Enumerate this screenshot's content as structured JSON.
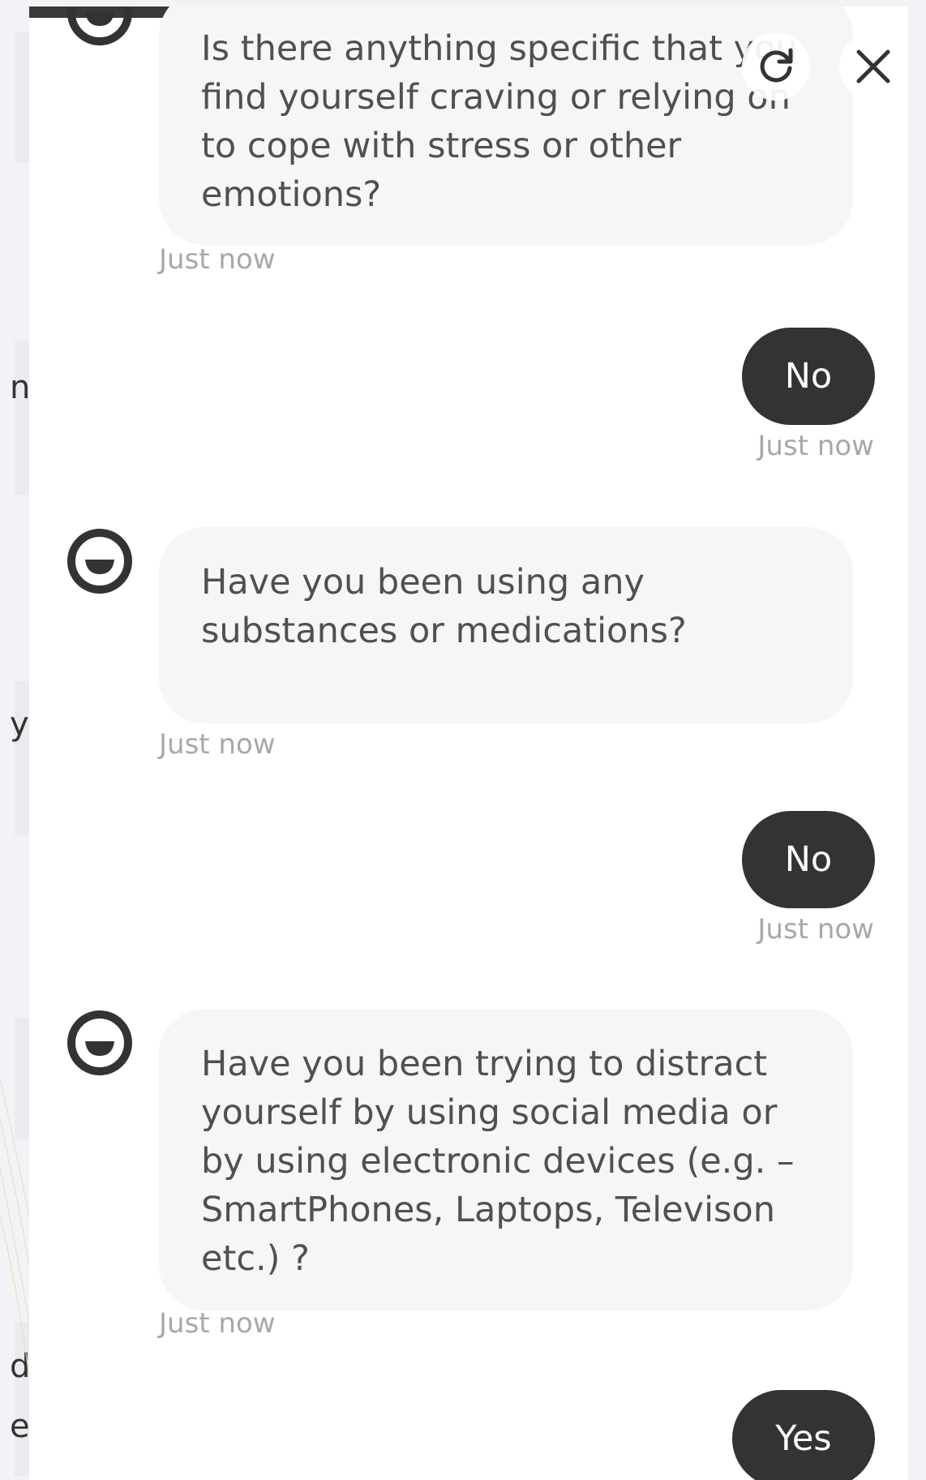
{
  "background": {
    "fragments": [
      "n",
      "y",
      "di",
      "e"
    ]
  },
  "chat": {
    "controls": {
      "refresh_icon": "refresh-icon",
      "close_icon": "close-icon"
    },
    "messages": [
      {
        "sender": "bot",
        "text": "Is there anything specific that you find yourself craving or relying on to cope with stress or other emotions?",
        "time": "Just now"
      },
      {
        "sender": "user",
        "text": "No",
        "time": "Just now"
      },
      {
        "sender": "bot",
        "text": "Have you been using any substances or medications?",
        "time": "Just now"
      },
      {
        "sender": "user",
        "text": "No",
        "time": "Just now"
      },
      {
        "sender": "bot",
        "text": "Have you been trying to distract yourself by using social media or by using electronic devices (e.g. – SmartPhones, Laptops, Televison etc.) ?",
        "time": "Just now"
      },
      {
        "sender": "user",
        "text": "Yes",
        "time": ""
      }
    ]
  },
  "colors": {
    "user_bubble": "#333333",
    "bot_bubble": "#f6f6f6",
    "bot_text": "#505050",
    "timestamp": "#a8a8a8"
  }
}
